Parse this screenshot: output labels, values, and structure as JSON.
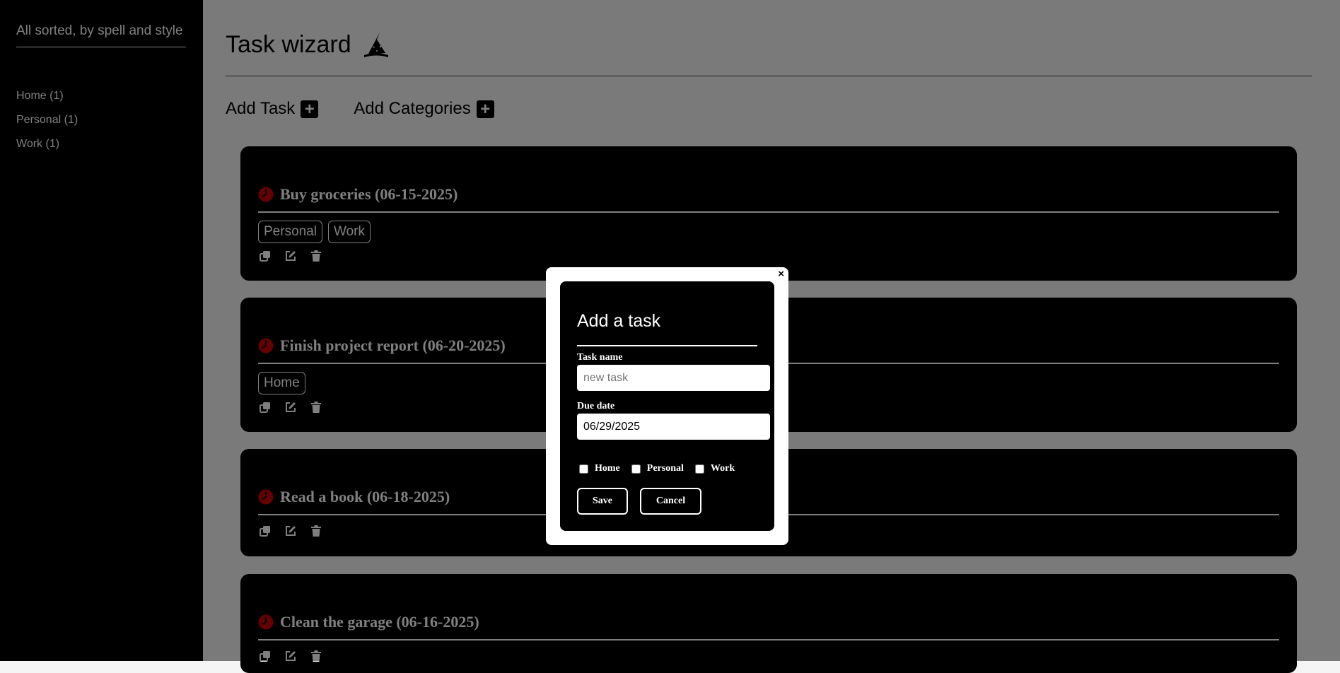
{
  "sidebar": {
    "tagline": "All sorted, by spell and style",
    "categories": [
      {
        "label": "Home (1)"
      },
      {
        "label": "Personal (1)"
      },
      {
        "label": "Work (1)"
      }
    ]
  },
  "header": {
    "title": "Task wizard",
    "add_task_label": "Add Task",
    "add_categories_label": "Add Categories",
    "plus_glyph": "+"
  },
  "tasks": [
    {
      "title": "Buy groceries (06-15-2025)",
      "tags": [
        "Personal",
        "Work"
      ]
    },
    {
      "title": "Finish project report (06-20-2025)",
      "tags": [
        "Home"
      ]
    },
    {
      "title": "Read a book (06-18-2025)",
      "tags": []
    },
    {
      "title": "Clean the garage (06-16-2025)",
      "tags": []
    }
  ],
  "modal": {
    "close_glyph": "×",
    "title": "Add a task",
    "task_name_label": "Task name",
    "task_name_placeholder": "new task",
    "due_date_label": "Due date",
    "due_date_value": "06/29/2025",
    "categories": [
      {
        "label": "Home"
      },
      {
        "label": "Personal"
      },
      {
        "label": "Work"
      }
    ],
    "save_label": "Save",
    "cancel_label": "Cancel"
  },
  "colors": {
    "accent_red": "#cc0000",
    "card_bg": "#000000",
    "overlay": "rgba(0,0,0,0.5)"
  }
}
